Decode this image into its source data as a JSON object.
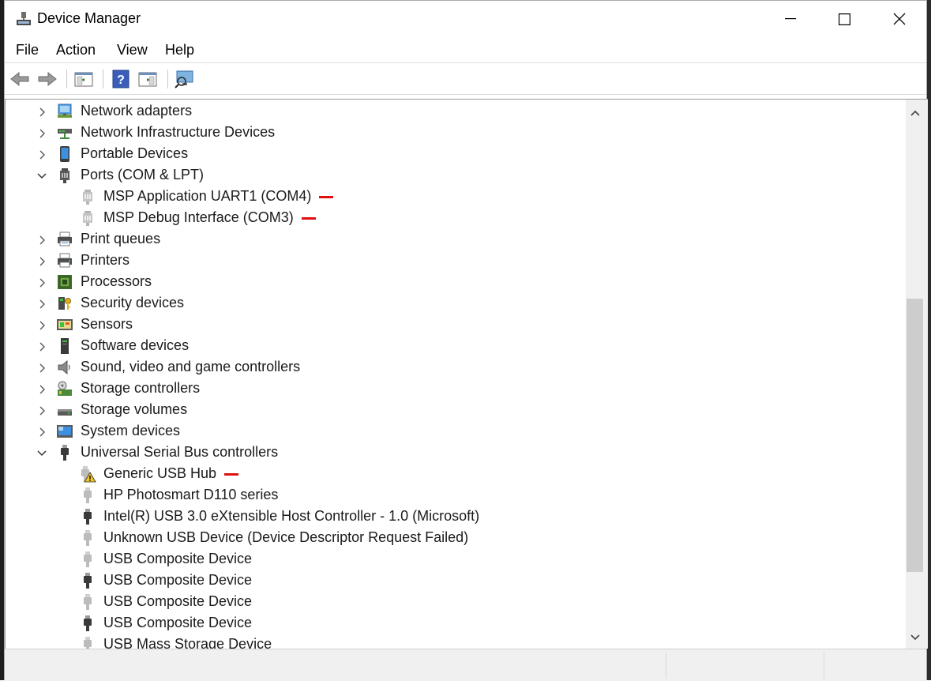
{
  "window": {
    "title": "Device Manager"
  },
  "menu": [
    "File",
    "Action",
    "View",
    "Help"
  ],
  "toolbar": {
    "buttons": [
      "back-icon",
      "forward-icon",
      "show-hide-console-tree-icon",
      "help-icon",
      "properties-icon",
      "scan-hardware-icon"
    ]
  },
  "tree": {
    "rows": [
      {
        "label": "Network adapters",
        "level": 0,
        "expanded": false,
        "icon": "network-adapter-icon"
      },
      {
        "label": "Network Infrastructure Devices",
        "level": 0,
        "expanded": false,
        "icon": "network-infrastructure-icon"
      },
      {
        "label": "Portable Devices",
        "level": 0,
        "expanded": false,
        "icon": "portable-device-icon"
      },
      {
        "label": "Ports (COM & LPT)",
        "level": 0,
        "expanded": true,
        "icon": "port-icon"
      },
      {
        "label": "MSP Application UART1 (COM4)",
        "level": 1,
        "icon": "port-device-icon",
        "marked": true
      },
      {
        "label": "MSP Debug Interface (COM3)",
        "level": 1,
        "icon": "port-device-icon",
        "marked": true
      },
      {
        "label": "Print queues",
        "level": 0,
        "expanded": false,
        "icon": "print-queue-icon"
      },
      {
        "label": "Printers",
        "level": 0,
        "expanded": false,
        "icon": "printer-icon"
      },
      {
        "label": "Processors",
        "level": 0,
        "expanded": false,
        "icon": "processor-icon"
      },
      {
        "label": "Security devices",
        "level": 0,
        "expanded": false,
        "icon": "security-device-icon"
      },
      {
        "label": "Sensors",
        "level": 0,
        "expanded": false,
        "icon": "sensor-icon"
      },
      {
        "label": "Software devices",
        "level": 0,
        "expanded": false,
        "icon": "software-device-icon"
      },
      {
        "label": "Sound, video and game controllers",
        "level": 0,
        "expanded": false,
        "icon": "speaker-icon"
      },
      {
        "label": "Storage controllers",
        "level": 0,
        "expanded": false,
        "icon": "storage-controller-icon"
      },
      {
        "label": "Storage volumes",
        "level": 0,
        "expanded": false,
        "icon": "storage-volume-icon"
      },
      {
        "label": "System devices",
        "level": 0,
        "expanded": false,
        "icon": "system-device-icon"
      },
      {
        "label": "Universal Serial Bus controllers",
        "level": 0,
        "expanded": true,
        "icon": "usb-plug-icon"
      },
      {
        "label": "Generic USB Hub",
        "level": 1,
        "icon": "usb-warning-icon",
        "marked": true
      },
      {
        "label": "HP Photosmart D110 series",
        "level": 1,
        "icon": "usb-plug-light-icon"
      },
      {
        "label": "Intel(R) USB 3.0 eXtensible Host Controller - 1.0 (Microsoft)",
        "level": 1,
        "icon": "usb-plug-icon"
      },
      {
        "label": "Unknown USB Device (Device Descriptor Request Failed)",
        "level": 1,
        "icon": "usb-plug-light-icon"
      },
      {
        "label": "USB Composite Device",
        "level": 1,
        "icon": "usb-plug-light-icon"
      },
      {
        "label": "USB Composite Device",
        "level": 1,
        "icon": "usb-plug-icon"
      },
      {
        "label": "USB Composite Device",
        "level": 1,
        "icon": "usb-plug-light-icon"
      },
      {
        "label": "USB Composite Device",
        "level": 1,
        "icon": "usb-plug-icon"
      },
      {
        "label": "USB Mass Storage Device",
        "level": 1,
        "icon": "usb-plug-light-icon"
      }
    ]
  },
  "colors": {
    "marker": "#e01010",
    "text": "#1a1a1a"
  }
}
